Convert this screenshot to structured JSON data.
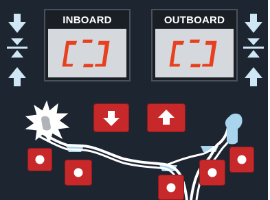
{
  "displays": {
    "inboard": {
      "label": "INBOARD",
      "readout": "[-]"
    },
    "outboard": {
      "label": "OUTBOARD",
      "readout": "[-]"
    }
  },
  "colors": {
    "panel_bg": "#1d2531",
    "icon_blue": "#cfe6f5",
    "button_red": "#c7282a",
    "segment_red": "#e8401f",
    "screen_bg": "#d5d8dc",
    "weight_blue": "#a9d4ee"
  },
  "icons": {
    "left_column": [
      "arrow-down-icon",
      "align-center-icon",
      "arrow-up-icon"
    ],
    "right_column": [
      "arrow-down-icon",
      "align-center-icon",
      "arrow-up-icon"
    ],
    "center_buttons": [
      "arrow-down-icon",
      "arrow-up-icon"
    ],
    "wheel": "wheel-profile-icon",
    "flash": "hammer-flash-icon",
    "hand": "clip-on-weight-icon"
  },
  "position_buttons": [
    "position-1",
    "position-2",
    "position-3",
    "position-4",
    "position-5"
  ]
}
